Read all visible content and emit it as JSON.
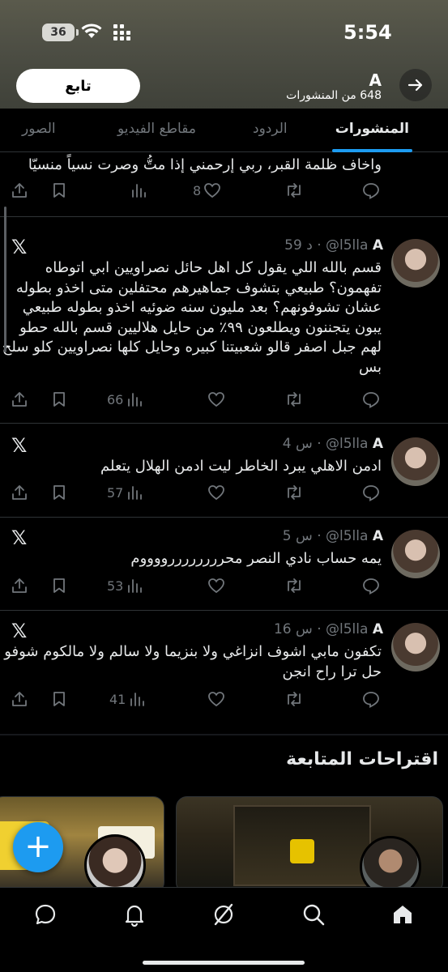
{
  "status": {
    "time": "5:54",
    "battery": "36"
  },
  "profile": {
    "name": "A",
    "post_count": "648 من المنشورات",
    "follow_label": "تابع"
  },
  "tabs": [
    {
      "label": "المنشورات",
      "active": true
    },
    {
      "label": "الردود",
      "active": false
    },
    {
      "label": "مقاطع الفيديو",
      "active": false
    },
    {
      "label": "الصور",
      "active": false
    }
  ],
  "partial_post": {
    "text": "واخاف ظلمة القبر، ربي إرحمني إذا متُّ وصرت نسياً منسيّا",
    "likes": "8"
  },
  "posts": [
    {
      "name": "A",
      "handle": "@l5lla",
      "time": "59 د",
      "text": "قسم بالله اللي يقول كل اهل حائل نصراويين ابي اتوطاه تفهمون؟ طبيعي بتشوف جماهيرهم محتفلين متى اخذو بطوله عشان تشوفونهم؟ بعد مليون سنه ضوئيه اخذو بطوله طبيعي يبون يتجننون ويطلعون ٩٩٪ من حايل هلاليين قسم بالله حطو لهم جبل اصفر قالو شعبيتنا كبيره وحايل كلها نصراويين كلو سلح بس",
      "views": "66"
    },
    {
      "name": "A",
      "handle": "@l5lla",
      "time": "4 س",
      "text": "ادمن الاهلي يبرد الخاطر ليت ادمن الهلال يتعلم",
      "views": "57"
    },
    {
      "name": "A",
      "handle": "@l5lla",
      "time": "5 س",
      "text": "يمه حساب نادي النصر محررررررررووووم",
      "views": "53"
    },
    {
      "name": "A",
      "handle": "@l5lla",
      "time": "16 س",
      "text": "تكفون مابي اشوف انزاغي ولا بنزيما ولا سالم ولا مالكوم شوفو حل ترا راح انجن",
      "views": "41"
    }
  ],
  "suggestions": {
    "title": "اقتراحات المتابعة"
  },
  "colors": {
    "accent": "#1d9bf0",
    "background": "#000000",
    "muted": "#71767b"
  }
}
